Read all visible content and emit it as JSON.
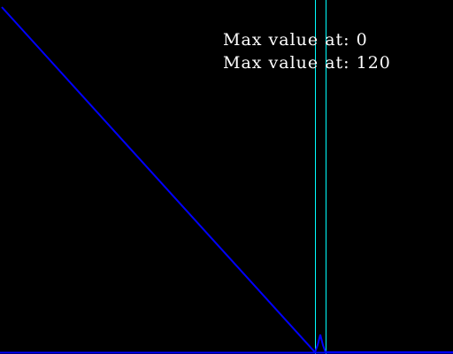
{
  "readouts": [
    {
      "prefix": "Max value at:",
      "value": "0"
    },
    {
      "prefix": "Max value at:",
      "value": "120"
    }
  ],
  "chart_data": {
    "type": "line",
    "title": "",
    "xlabel": "",
    "ylabel": "",
    "xlim": [
      0,
      170
    ],
    "ylim": [
      0,
      100
    ],
    "grid": false,
    "series": [
      {
        "color": "#0000ff",
        "x": [
          0,
          118,
          119,
          120,
          121,
          122,
          170
        ],
        "y": [
          98,
          0,
          2,
          5,
          2,
          0,
          0
        ]
      }
    ],
    "markers": [
      {
        "color": "#00ffff",
        "x": 118
      },
      {
        "color": "#00ffff",
        "x": 122
      }
    ]
  }
}
